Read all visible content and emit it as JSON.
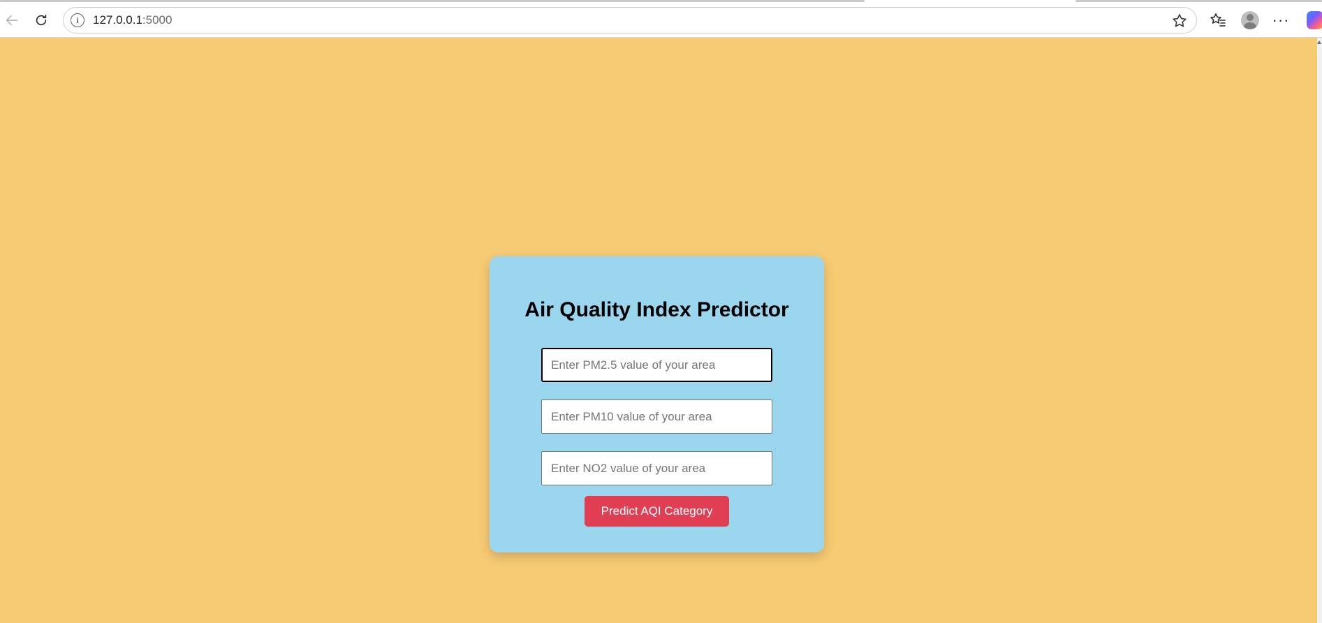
{
  "browser": {
    "url_host": "127.0.0.1",
    "url_port": ":5000",
    "info_glyph": "i",
    "more_glyph": "···",
    "icons": {
      "back": "back-arrow-icon",
      "reload": "reload-icon",
      "info": "site-info-icon",
      "favorite": "star-icon",
      "favorites": "favorites-icon",
      "profile": "profile-icon",
      "more": "more-icon",
      "copilot": "copilot-icon"
    }
  },
  "page": {
    "background": "#f7cb74",
    "card_background": "#9ad7ef",
    "title": "Air Quality Index Predictor",
    "fields": [
      {
        "placeholder": "Enter PM2.5 value of your area",
        "value": ""
      },
      {
        "placeholder": "Enter PM10 value of your area",
        "value": ""
      },
      {
        "placeholder": "Enter NO2 value of your area",
        "value": ""
      }
    ],
    "submit_label": "Predict AQI Category",
    "submit_color": "#e03e53"
  }
}
